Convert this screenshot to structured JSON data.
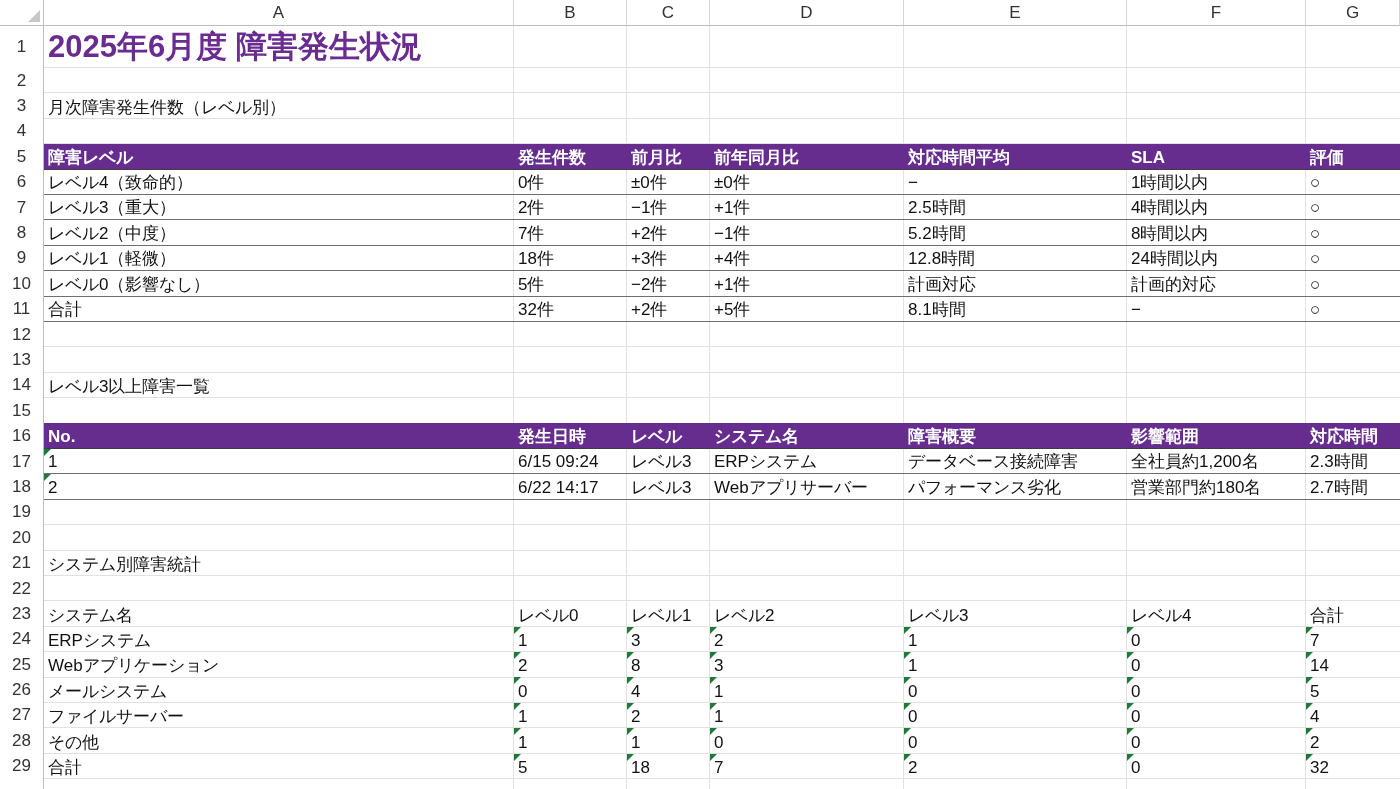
{
  "columns": [
    "A",
    "B",
    "C",
    "D",
    "E",
    "F",
    "G"
  ],
  "rows": [
    {
      "row": "1",
      "kind": "title",
      "cells": [
        {
          "text": "2025年6月度 障害発生状況"
        },
        null,
        null,
        null,
        null,
        null,
        null
      ]
    },
    {
      "row": "2",
      "kind": "plain",
      "cells": [
        null,
        null,
        null,
        null,
        null,
        null,
        null
      ]
    },
    {
      "row": "3",
      "kind": "plain",
      "cells": [
        {
          "text": "月次障害発生件数（レベル別）"
        },
        null,
        null,
        null,
        null,
        null,
        null
      ]
    },
    {
      "row": "4",
      "kind": "plain",
      "cells": [
        null,
        null,
        null,
        null,
        null,
        null,
        null
      ]
    },
    {
      "row": "5",
      "kind": "header",
      "cells": [
        {
          "text": "障害レベル"
        },
        {
          "text": "発生件数"
        },
        {
          "text": "前月比"
        },
        {
          "text": "前年同月比"
        },
        {
          "text": "対応時間平均"
        },
        {
          "text": "SLA"
        },
        {
          "text": "評価"
        }
      ]
    },
    {
      "row": "6",
      "kind": "ruled",
      "cells": [
        {
          "text": "レベル4（致命的）"
        },
        {
          "text": "0件"
        },
        {
          "text": "±0件"
        },
        {
          "text": "±0件"
        },
        {
          "text": "−"
        },
        {
          "text": "1時間以内"
        },
        {
          "text": "○"
        }
      ]
    },
    {
      "row": "7",
      "kind": "ruled",
      "cells": [
        {
          "text": "レベル3（重大）"
        },
        {
          "text": "2件"
        },
        {
          "text": "−1件"
        },
        {
          "text": "+1件"
        },
        {
          "text": "2.5時間"
        },
        {
          "text": "4時間以内"
        },
        {
          "text": "○"
        }
      ]
    },
    {
      "row": "8",
      "kind": "ruled",
      "cells": [
        {
          "text": "レベル2（中度）"
        },
        {
          "text": "7件"
        },
        {
          "text": "+2件"
        },
        {
          "text": "−1件"
        },
        {
          "text": "5.2時間"
        },
        {
          "text": "8時間以内"
        },
        {
          "text": "○"
        }
      ]
    },
    {
      "row": "9",
      "kind": "ruled",
      "cells": [
        {
          "text": "レベル1（軽微）"
        },
        {
          "text": "18件"
        },
        {
          "text": "+3件"
        },
        {
          "text": "+4件"
        },
        {
          "text": "12.8時間"
        },
        {
          "text": "24時間以内"
        },
        {
          "text": "○"
        }
      ]
    },
    {
      "row": "10",
      "kind": "ruled",
      "cells": [
        {
          "text": "レベル0（影響なし）"
        },
        {
          "text": "5件"
        },
        {
          "text": "−2件"
        },
        {
          "text": "+1件"
        },
        {
          "text": "計画対応"
        },
        {
          "text": "計画的対応"
        },
        {
          "text": "○"
        }
      ]
    },
    {
      "row": "11",
      "kind": "ruled",
      "cells": [
        {
          "text": "合計"
        },
        {
          "text": "32件"
        },
        {
          "text": "+2件"
        },
        {
          "text": "+5件"
        },
        {
          "text": "8.1時間"
        },
        {
          "text": "−"
        },
        {
          "text": "○"
        }
      ]
    },
    {
      "row": "12",
      "kind": "plain",
      "cells": [
        null,
        null,
        null,
        null,
        null,
        null,
        null
      ]
    },
    {
      "row": "13",
      "kind": "plain",
      "cells": [
        null,
        null,
        null,
        null,
        null,
        null,
        null
      ]
    },
    {
      "row": "14",
      "kind": "plain",
      "cells": [
        {
          "text": "レベル3以上障害一覧"
        },
        null,
        null,
        null,
        null,
        null,
        null
      ]
    },
    {
      "row": "15",
      "kind": "plain",
      "cells": [
        null,
        null,
        null,
        null,
        null,
        null,
        null
      ]
    },
    {
      "row": "16",
      "kind": "header",
      "cells": [
        {
          "text": "No."
        },
        {
          "text": "発生日時"
        },
        {
          "text": "レベル"
        },
        {
          "text": "システム名"
        },
        {
          "text": "障害概要"
        },
        {
          "text": "影響範囲"
        },
        {
          "text": "対応時間"
        }
      ]
    },
    {
      "row": "17",
      "kind": "ruled",
      "cells": [
        {
          "text": "1",
          "flag": true
        },
        {
          "text": "6/15 09:24"
        },
        {
          "text": "レベル3"
        },
        {
          "text": "ERPシステム"
        },
        {
          "text": "データベース接続障害"
        },
        {
          "text": "全社員約1,200名"
        },
        {
          "text": "2.3時間"
        }
      ]
    },
    {
      "row": "18",
      "kind": "ruled",
      "cells": [
        {
          "text": "2",
          "flag": true
        },
        {
          "text": "6/22 14:17"
        },
        {
          "text": "レベル3"
        },
        {
          "text": "Webアプリサーバー"
        },
        {
          "text": "パフォーマンス劣化"
        },
        {
          "text": "営業部門約180名"
        },
        {
          "text": "2.7時間"
        }
      ]
    },
    {
      "row": "19",
      "kind": "plain",
      "cells": [
        null,
        null,
        null,
        null,
        null,
        null,
        null
      ]
    },
    {
      "row": "20",
      "kind": "plain",
      "cells": [
        null,
        null,
        null,
        null,
        null,
        null,
        null
      ]
    },
    {
      "row": "21",
      "kind": "plain",
      "cells": [
        {
          "text": "システム別障害統計"
        },
        null,
        null,
        null,
        null,
        null,
        null
      ]
    },
    {
      "row": "22",
      "kind": "plain",
      "cells": [
        null,
        null,
        null,
        null,
        null,
        null,
        null
      ]
    },
    {
      "row": "23",
      "kind": "plain",
      "cells": [
        {
          "text": "システム名"
        },
        {
          "text": "レベル0"
        },
        {
          "text": "レベル1"
        },
        {
          "text": "レベル2"
        },
        {
          "text": "レベル3"
        },
        {
          "text": "レベル4"
        },
        {
          "text": "合計"
        }
      ]
    },
    {
      "row": "24",
      "kind": "plain",
      "cells": [
        {
          "text": "ERPシステム"
        },
        {
          "text": "1",
          "flag": true
        },
        {
          "text": "3",
          "flag": true
        },
        {
          "text": "2",
          "flag": true
        },
        {
          "text": "1",
          "flag": true
        },
        {
          "text": "0",
          "flag": true
        },
        {
          "text": "7",
          "flag": true
        }
      ]
    },
    {
      "row": "25",
      "kind": "plain",
      "cells": [
        {
          "text": "Webアプリケーション"
        },
        {
          "text": "2",
          "flag": true
        },
        {
          "text": "8",
          "flag": true
        },
        {
          "text": "3",
          "flag": true
        },
        {
          "text": "1",
          "flag": true
        },
        {
          "text": "0",
          "flag": true
        },
        {
          "text": "14",
          "flag": true
        }
      ]
    },
    {
      "row": "26",
      "kind": "plain",
      "cells": [
        {
          "text": "メールシステム"
        },
        {
          "text": "0",
          "flag": true
        },
        {
          "text": "4",
          "flag": true
        },
        {
          "text": "1",
          "flag": true
        },
        {
          "text": "0",
          "flag": true
        },
        {
          "text": "0",
          "flag": true
        },
        {
          "text": "5",
          "flag": true
        }
      ]
    },
    {
      "row": "27",
      "kind": "plain",
      "cells": [
        {
          "text": "ファイルサーバー"
        },
        {
          "text": "1",
          "flag": true
        },
        {
          "text": "2",
          "flag": true
        },
        {
          "text": "1",
          "flag": true
        },
        {
          "text": "0",
          "flag": true
        },
        {
          "text": "0",
          "flag": true
        },
        {
          "text": "4",
          "flag": true
        }
      ]
    },
    {
      "row": "28",
      "kind": "plain",
      "cells": [
        {
          "text": "その他"
        },
        {
          "text": "1",
          "flag": true
        },
        {
          "text": "1",
          "flag": true
        },
        {
          "text": "0",
          "flag": true
        },
        {
          "text": "0",
          "flag": true
        },
        {
          "text": "0",
          "flag": true
        },
        {
          "text": "2",
          "flag": true
        }
      ]
    },
    {
      "row": "29",
      "kind": "plain",
      "cells": [
        {
          "text": "合計"
        },
        {
          "text": "5",
          "flag": true
        },
        {
          "text": "18",
          "flag": true
        },
        {
          "text": "7",
          "flag": true
        },
        {
          "text": "2",
          "flag": true
        },
        {
          "text": "0",
          "flag": true
        },
        {
          "text": "32",
          "flag": true
        }
      ]
    }
  ]
}
